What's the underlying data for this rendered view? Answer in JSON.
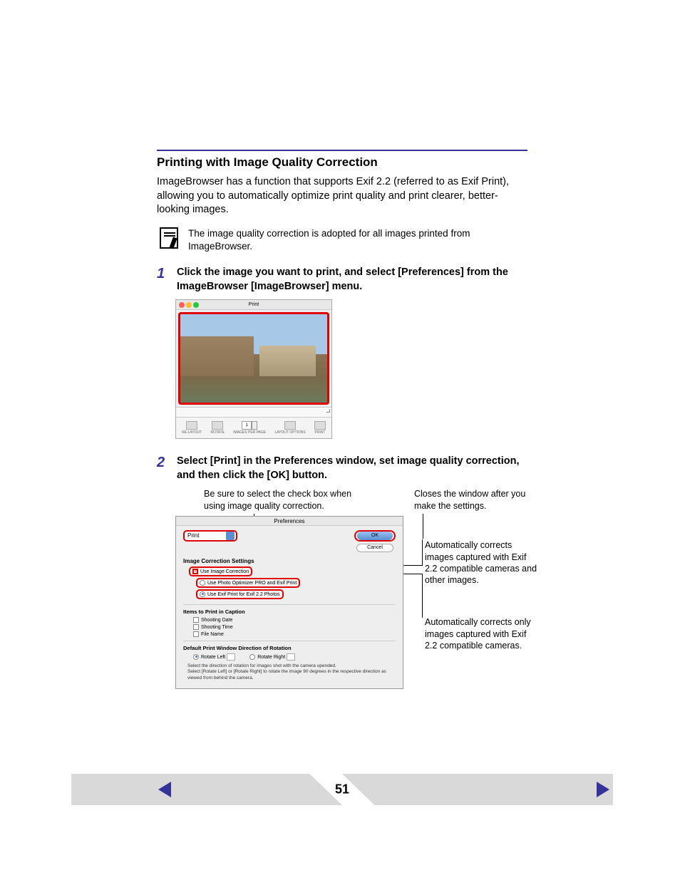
{
  "section_title": "Printing with Image Quality Correction",
  "intro": "ImageBrowser has a function that supports Exif 2.2 (referred to as Exif Print), allowing you to automatically optimize print quality and print clearer, better-looking images.",
  "note": "The image quality correction is adopted for all images printed from ImageBrowser.",
  "steps": {
    "s1": {
      "num": "1",
      "text": "Click the image you want to print, and select [Preferences] from the ImageBrowser [ImageBrowser] menu."
    },
    "s2": {
      "num": "2",
      "text": "Select [Print] in the Preferences window, set image quality correction, and then click the [OK] button."
    }
  },
  "print_window": {
    "title": "Print",
    "toolbar": {
      "relayout": "RE-LAYOUT",
      "rotate": "ROTATE",
      "per_page_value": "1",
      "per_page_label": "IMAGES\nPER PAGE",
      "layout": "LAYOUT\nOPTIONS",
      "print": "PRINT"
    }
  },
  "callouts": {
    "top_left": "Be sure to select the check box when using image quality correction.",
    "top_right": "Closes the window after you make the settings.",
    "side1": "Automatically corrects images captured with Exif 2.2 compatible cameras and other images.",
    "side2": "Automatically corrects only images captured with Exif 2.2 compatible cameras."
  },
  "pref": {
    "title": "Preferences",
    "select": "Print",
    "ok": "OK",
    "cancel": "Cancel",
    "group_image_correction": "Image Correction Settings",
    "use_image_correction": "Use Image Correction",
    "opt_photo_optimizer": "Use Photo Optimizer PRO and Exif Print",
    "opt_exif_print": "Use Exif Print for Exif 2.2 Photos",
    "group_caption": "Items to Print in Caption",
    "shooting_date": "Shooting Date",
    "shooting_time": "Shooting Time",
    "file_name": "File Name",
    "group_rotation": "Default Print Window Direction of Rotation",
    "rotate_left": "Rotate Left",
    "rotate_right": "Rotate Right",
    "help1": "Select the direction of rotation for images shot with the camera upended.",
    "help2": "Select [Rotate Left] or [Rotate Right] to rotate the image 90 degrees in the respective direction as viewed from behind the camera."
  },
  "page_number": "51"
}
